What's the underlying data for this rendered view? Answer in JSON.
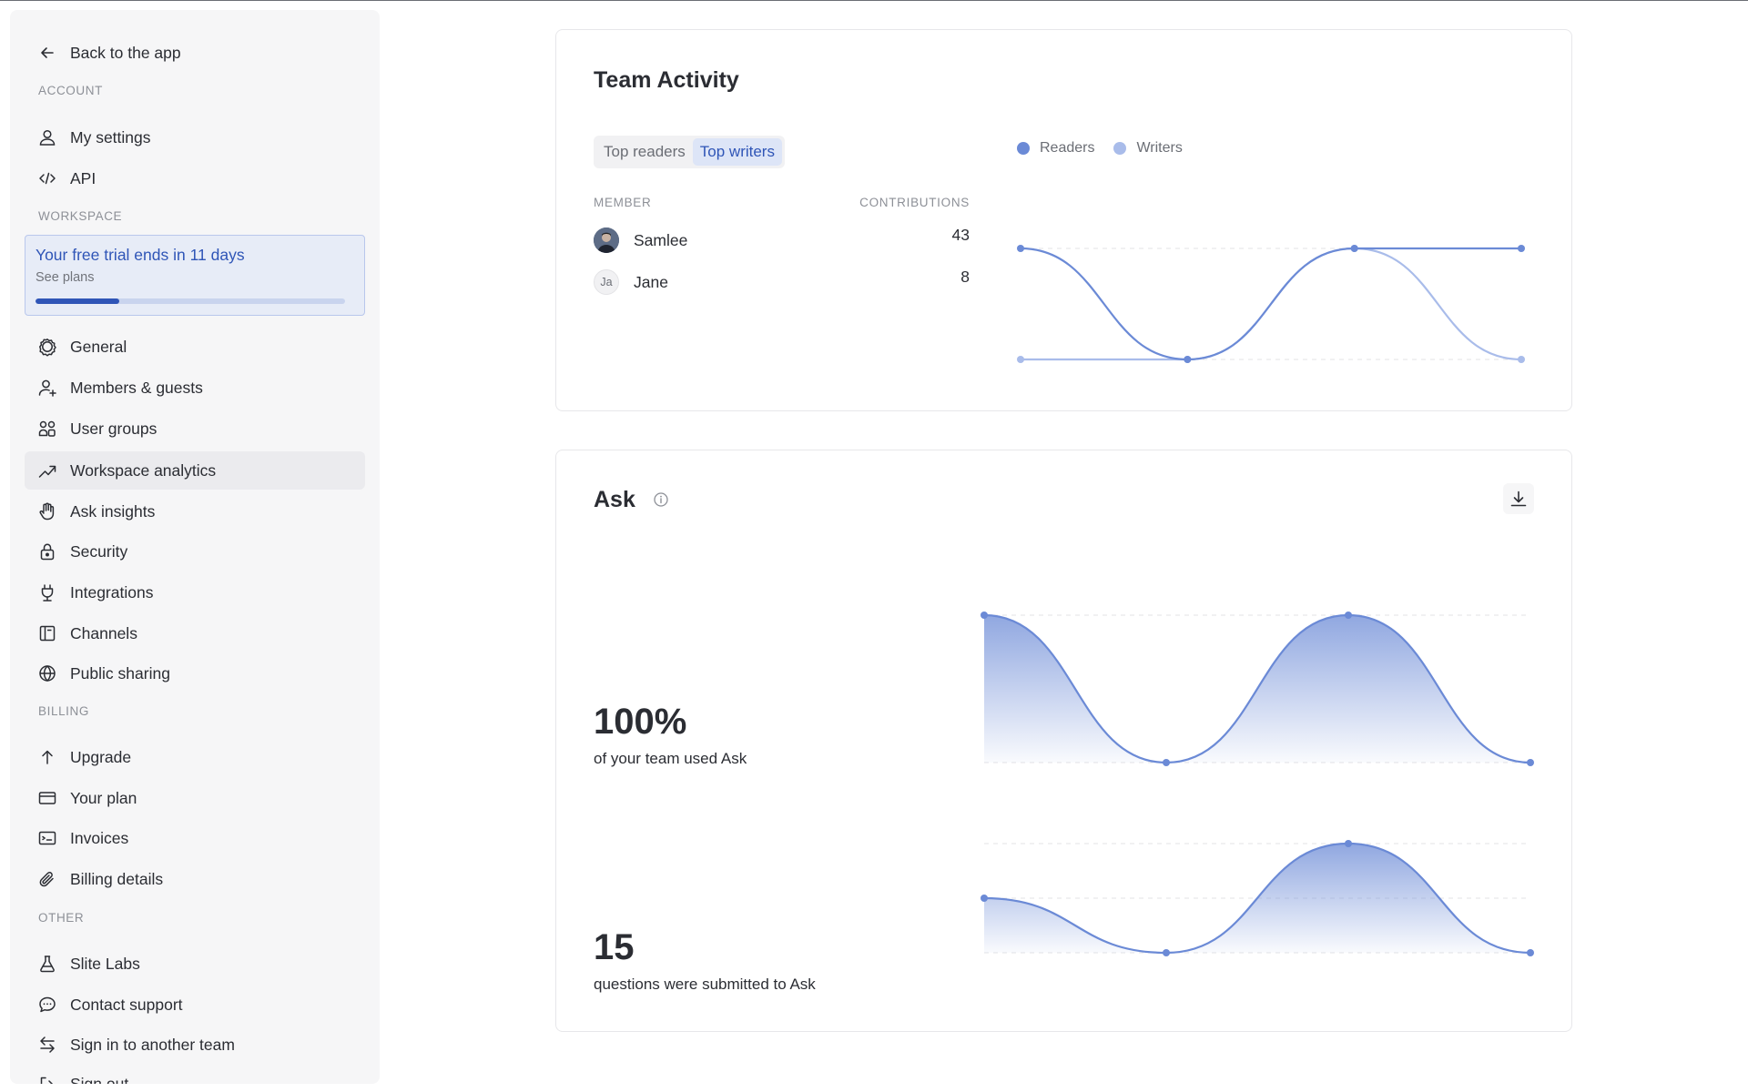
{
  "sidebar": {
    "back": "Back to the app",
    "sections": {
      "account": "ACCOUNT",
      "workspace": "WORKSPACE",
      "billing": "BILLING",
      "other": "OTHER"
    },
    "account_items": [
      {
        "label": "My settings",
        "icon": "user-icon"
      },
      {
        "label": "API",
        "icon": "code-icon"
      }
    ],
    "trial": {
      "title": "Your free trial ends in 11 days",
      "subtitle": "See plans",
      "progress": 0.27
    },
    "workspace_items": [
      {
        "label": "General",
        "icon": "gear-icon"
      },
      {
        "label": "Members & guests",
        "icon": "user-plus-icon"
      },
      {
        "label": "User groups",
        "icon": "users-icon"
      },
      {
        "label": "Workspace analytics",
        "icon": "trending-up-icon",
        "active": true
      },
      {
        "label": "Ask insights",
        "icon": "hand-icon"
      },
      {
        "label": "Security",
        "icon": "lock-icon"
      },
      {
        "label": "Integrations",
        "icon": "plug-icon"
      },
      {
        "label": "Channels",
        "icon": "channel-icon"
      },
      {
        "label": "Public sharing",
        "icon": "globe-icon"
      }
    ],
    "billing_items": [
      {
        "label": "Upgrade",
        "icon": "arrow-up-icon"
      },
      {
        "label": "Your plan",
        "icon": "credit-card-icon"
      },
      {
        "label": "Invoices",
        "icon": "invoice-icon"
      },
      {
        "label": "Billing details",
        "icon": "paperclip-icon"
      }
    ],
    "other_items": [
      {
        "label": "Slite Labs",
        "icon": "flask-icon"
      },
      {
        "label": "Contact support",
        "icon": "chat-icon"
      },
      {
        "label": "Sign in to another team",
        "icon": "switch-icon"
      },
      {
        "label": "Sign out",
        "icon": "sign-out-icon"
      }
    ]
  },
  "team_activity": {
    "title": "Team Activity",
    "tabs": [
      {
        "label": "Top readers",
        "active": false
      },
      {
        "label": "Top writers",
        "active": true
      }
    ],
    "columns": {
      "member": "MEMBER",
      "contributions": "CONTRIBUTIONS"
    },
    "members": [
      {
        "name": "Samlee",
        "initials": "",
        "contributions": "43"
      },
      {
        "name": "Jane",
        "initials": "Ja",
        "contributions": "8"
      }
    ]
  },
  "ask": {
    "title": "Ask",
    "stat1": {
      "value": "100%",
      "label": "of your team used Ask"
    },
    "stat2": {
      "value": "15",
      "label": "questions were submitted to Ask"
    }
  },
  "colors": {
    "readers": "#6b8ad6",
    "writers": "#a9bcea",
    "accent": "#2f55b7"
  },
  "chart_data": [
    {
      "type": "line",
      "series": [
        {
          "name": "Readers",
          "values": [
            1,
            0,
            1,
            1
          ]
        },
        {
          "name": "Writers",
          "values": [
            0,
            0,
            1,
            0
          ]
        }
      ],
      "ylim": [
        0,
        1
      ],
      "grid": true,
      "legend": "top"
    },
    {
      "type": "area",
      "values": [
        1,
        0,
        1,
        0
      ],
      "ylim": [
        0,
        1
      ],
      "grid": true
    },
    {
      "type": "area",
      "values": [
        1,
        0,
        2,
        0
      ],
      "ylim": [
        0,
        2
      ],
      "grid": true
    }
  ]
}
